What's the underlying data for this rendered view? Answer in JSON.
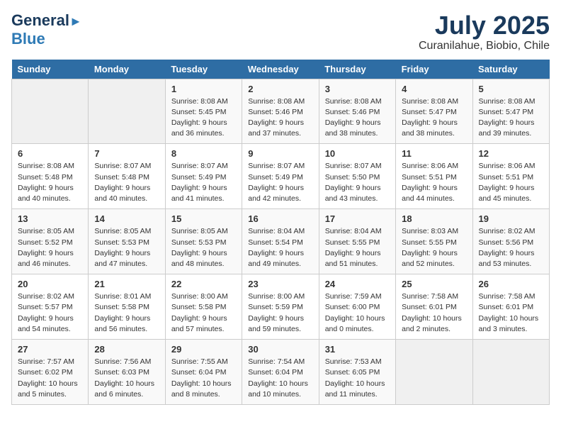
{
  "header": {
    "logo_line1": "General",
    "logo_line2": "Blue",
    "month": "July 2025",
    "location": "Curanilahue, Biobio, Chile"
  },
  "weekdays": [
    "Sunday",
    "Monday",
    "Tuesday",
    "Wednesday",
    "Thursday",
    "Friday",
    "Saturday"
  ],
  "weeks": [
    [
      {
        "day": "",
        "info": ""
      },
      {
        "day": "",
        "info": ""
      },
      {
        "day": "1",
        "info": "Sunrise: 8:08 AM\nSunset: 5:45 PM\nDaylight: 9 hours\nand 36 minutes."
      },
      {
        "day": "2",
        "info": "Sunrise: 8:08 AM\nSunset: 5:46 PM\nDaylight: 9 hours\nand 37 minutes."
      },
      {
        "day": "3",
        "info": "Sunrise: 8:08 AM\nSunset: 5:46 PM\nDaylight: 9 hours\nand 38 minutes."
      },
      {
        "day": "4",
        "info": "Sunrise: 8:08 AM\nSunset: 5:47 PM\nDaylight: 9 hours\nand 38 minutes."
      },
      {
        "day": "5",
        "info": "Sunrise: 8:08 AM\nSunset: 5:47 PM\nDaylight: 9 hours\nand 39 minutes."
      }
    ],
    [
      {
        "day": "6",
        "info": "Sunrise: 8:08 AM\nSunset: 5:48 PM\nDaylight: 9 hours\nand 40 minutes."
      },
      {
        "day": "7",
        "info": "Sunrise: 8:07 AM\nSunset: 5:48 PM\nDaylight: 9 hours\nand 40 minutes."
      },
      {
        "day": "8",
        "info": "Sunrise: 8:07 AM\nSunset: 5:49 PM\nDaylight: 9 hours\nand 41 minutes."
      },
      {
        "day": "9",
        "info": "Sunrise: 8:07 AM\nSunset: 5:49 PM\nDaylight: 9 hours\nand 42 minutes."
      },
      {
        "day": "10",
        "info": "Sunrise: 8:07 AM\nSunset: 5:50 PM\nDaylight: 9 hours\nand 43 minutes."
      },
      {
        "day": "11",
        "info": "Sunrise: 8:06 AM\nSunset: 5:51 PM\nDaylight: 9 hours\nand 44 minutes."
      },
      {
        "day": "12",
        "info": "Sunrise: 8:06 AM\nSunset: 5:51 PM\nDaylight: 9 hours\nand 45 minutes."
      }
    ],
    [
      {
        "day": "13",
        "info": "Sunrise: 8:05 AM\nSunset: 5:52 PM\nDaylight: 9 hours\nand 46 minutes."
      },
      {
        "day": "14",
        "info": "Sunrise: 8:05 AM\nSunset: 5:53 PM\nDaylight: 9 hours\nand 47 minutes."
      },
      {
        "day": "15",
        "info": "Sunrise: 8:05 AM\nSunset: 5:53 PM\nDaylight: 9 hours\nand 48 minutes."
      },
      {
        "day": "16",
        "info": "Sunrise: 8:04 AM\nSunset: 5:54 PM\nDaylight: 9 hours\nand 49 minutes."
      },
      {
        "day": "17",
        "info": "Sunrise: 8:04 AM\nSunset: 5:55 PM\nDaylight: 9 hours\nand 51 minutes."
      },
      {
        "day": "18",
        "info": "Sunrise: 8:03 AM\nSunset: 5:55 PM\nDaylight: 9 hours\nand 52 minutes."
      },
      {
        "day": "19",
        "info": "Sunrise: 8:02 AM\nSunset: 5:56 PM\nDaylight: 9 hours\nand 53 minutes."
      }
    ],
    [
      {
        "day": "20",
        "info": "Sunrise: 8:02 AM\nSunset: 5:57 PM\nDaylight: 9 hours\nand 54 minutes."
      },
      {
        "day": "21",
        "info": "Sunrise: 8:01 AM\nSunset: 5:58 PM\nDaylight: 9 hours\nand 56 minutes."
      },
      {
        "day": "22",
        "info": "Sunrise: 8:00 AM\nSunset: 5:58 PM\nDaylight: 9 hours\nand 57 minutes."
      },
      {
        "day": "23",
        "info": "Sunrise: 8:00 AM\nSunset: 5:59 PM\nDaylight: 9 hours\nand 59 minutes."
      },
      {
        "day": "24",
        "info": "Sunrise: 7:59 AM\nSunset: 6:00 PM\nDaylight: 10 hours\nand 0 minutes."
      },
      {
        "day": "25",
        "info": "Sunrise: 7:58 AM\nSunset: 6:01 PM\nDaylight: 10 hours\nand 2 minutes."
      },
      {
        "day": "26",
        "info": "Sunrise: 7:58 AM\nSunset: 6:01 PM\nDaylight: 10 hours\nand 3 minutes."
      }
    ],
    [
      {
        "day": "27",
        "info": "Sunrise: 7:57 AM\nSunset: 6:02 PM\nDaylight: 10 hours\nand 5 minutes."
      },
      {
        "day": "28",
        "info": "Sunrise: 7:56 AM\nSunset: 6:03 PM\nDaylight: 10 hours\nand 6 minutes."
      },
      {
        "day": "29",
        "info": "Sunrise: 7:55 AM\nSunset: 6:04 PM\nDaylight: 10 hours\nand 8 minutes."
      },
      {
        "day": "30",
        "info": "Sunrise: 7:54 AM\nSunset: 6:04 PM\nDaylight: 10 hours\nand 10 minutes."
      },
      {
        "day": "31",
        "info": "Sunrise: 7:53 AM\nSunset: 6:05 PM\nDaylight: 10 hours\nand 11 minutes."
      },
      {
        "day": "",
        "info": ""
      },
      {
        "day": "",
        "info": ""
      }
    ]
  ]
}
